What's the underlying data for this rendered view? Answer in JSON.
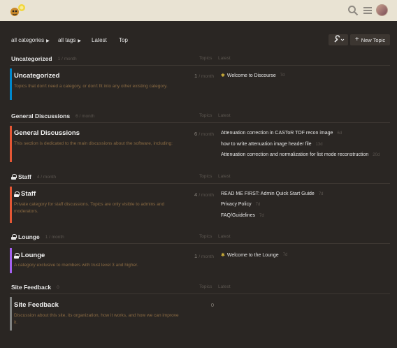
{
  "header": {
    "logo_icon": "discourse-logo-icon",
    "search_icon": "search-icon",
    "menu_icon": "hamburger-menu-icon",
    "avatar_icon": "user-avatar"
  },
  "nav": {
    "categories_label": "all categories",
    "tags_label": "all tags",
    "latest_label": "Latest",
    "top_label": "Top",
    "wrench_icon": "wrench-icon",
    "new_topic_label": "New Topic"
  },
  "labels": {
    "topics": "Topics",
    "latest": "Latest"
  },
  "sections": [
    {
      "header_name": "Uncategorized",
      "header_count": "1 / month",
      "name": "Uncategorized",
      "description": "Topics that don't need a category, or don't fit into any other existing category.",
      "count_num": "1",
      "count_unit": "/ month",
      "color": "#0088cc",
      "locked": false,
      "topics": [
        {
          "title": "Welcome to Discourse",
          "age": "7d",
          "pinned": true
        }
      ]
    },
    {
      "header_name": "General Discussions",
      "header_count": "6 / month",
      "name": "General Discussions",
      "description": "This section is dedicated to the main discussions about the software, including:",
      "count_num": "6",
      "count_unit": "/ month",
      "color": "#e45735",
      "locked": false,
      "topics": [
        {
          "title": "Attenuation correction in CASToR TOF recon image",
          "age": "6d",
          "pinned": false
        },
        {
          "title": "how to write attenuation image header file",
          "age": "13d",
          "pinned": false
        },
        {
          "title": "Attenuation correction and normalization for list mode reconstruction",
          "age": "20d",
          "pinned": false
        }
      ]
    },
    {
      "header_name": "Staff",
      "header_count": "4 / month",
      "name": "Staff",
      "description": "Private category for staff discussions. Topics are only visible to admins and moderators.",
      "count_num": "4",
      "count_unit": "/ month",
      "color": "#e45735",
      "locked": true,
      "topics": [
        {
          "title": "READ ME FIRST: Admin Quick Start Guide",
          "age": "7d",
          "pinned": false
        },
        {
          "title": "Privacy Policy",
          "age": "7d",
          "pinned": false
        },
        {
          "title": "FAQ/Guidelines",
          "age": "7d",
          "pinned": false
        }
      ]
    },
    {
      "header_name": "Lounge",
      "header_count": "1 / month",
      "name": "Lounge",
      "description": "A category exclusive to members with trust level 3 and higher.",
      "count_num": "1",
      "count_unit": "/ month",
      "color": "#a461ef",
      "locked": true,
      "topics": [
        {
          "title": "Welcome to the Lounge",
          "age": "7d",
          "pinned": true
        }
      ]
    },
    {
      "header_name": "Site Feedback",
      "header_count": "0",
      "name": "Site Feedback",
      "description": "Discussion about this site, its organization, how it works, and how we can improve it.",
      "count_num": "0",
      "count_unit": "",
      "color": "#808281",
      "locked": false,
      "topics": []
    }
  ]
}
